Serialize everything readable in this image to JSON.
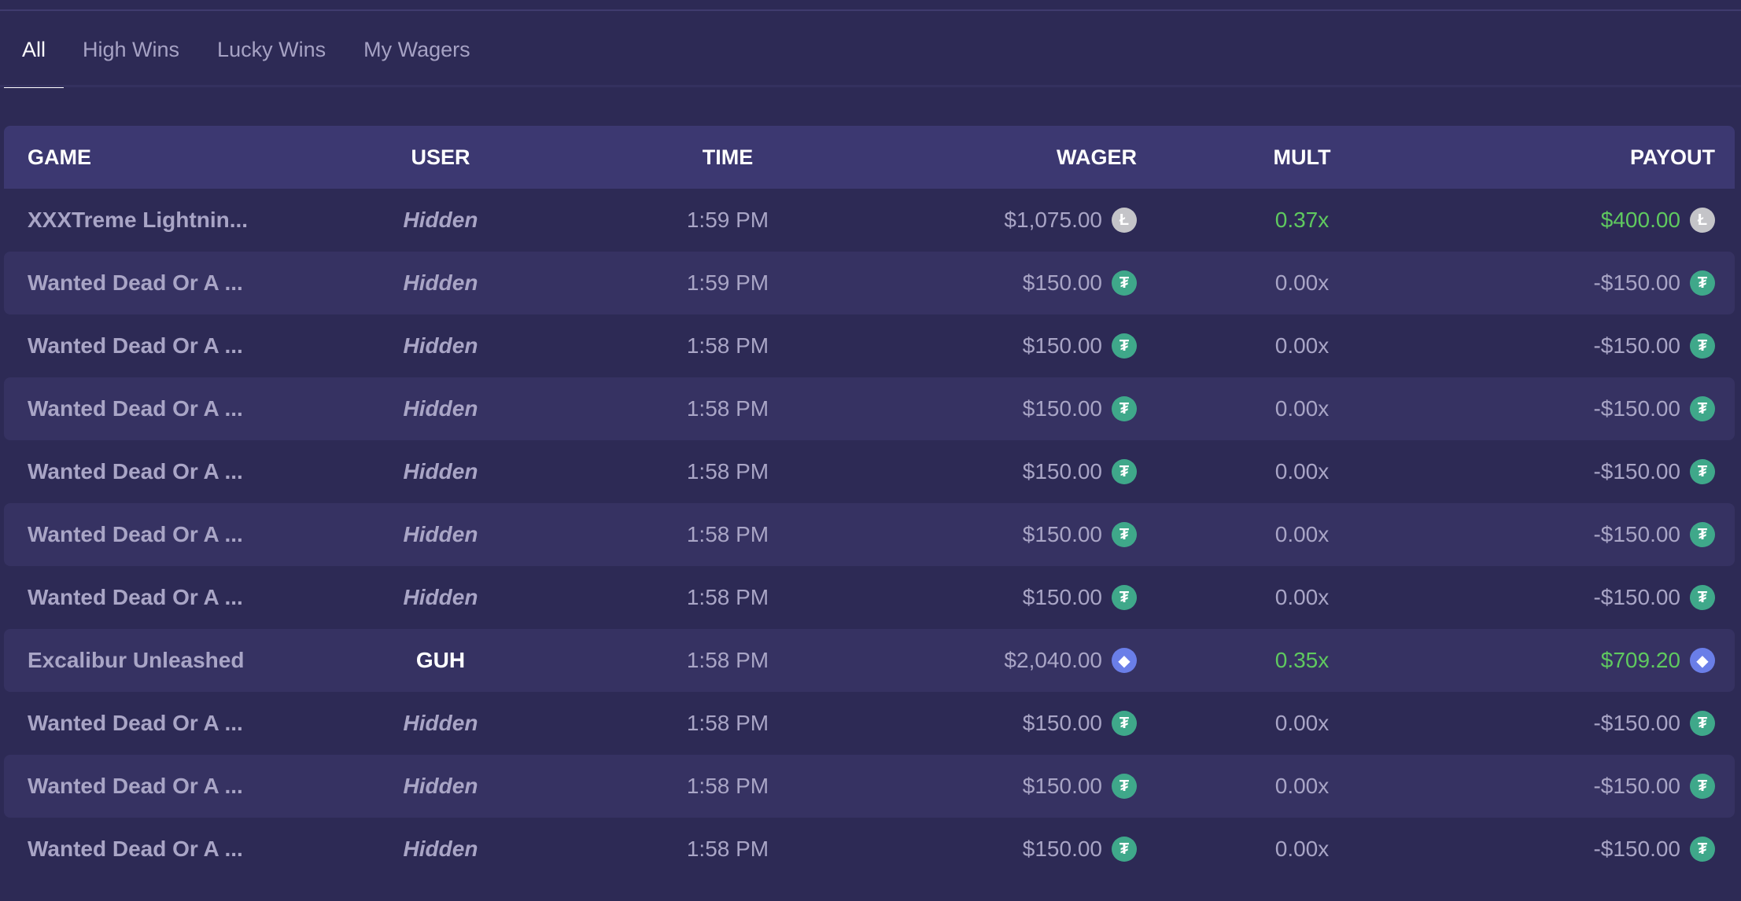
{
  "tabs": [
    {
      "label": "All",
      "active": true
    },
    {
      "label": "High Wins",
      "active": false
    },
    {
      "label": "Lucky Wins",
      "active": false
    },
    {
      "label": "My Wagers",
      "active": false
    }
  ],
  "columns": {
    "game": "GAME",
    "user": "USER",
    "time": "TIME",
    "wager": "WAGER",
    "mult": "MULT",
    "payout": "PAYOUT"
  },
  "rows": [
    {
      "game": "XXXTreme Lightnin...",
      "user": "Hidden",
      "hidden": true,
      "time": "1:59 PM",
      "wager": "$1,075.00",
      "currency": "ltc",
      "mult": "0.37x",
      "payout": "$400.00",
      "win": true
    },
    {
      "game": "Wanted Dead Or A ...",
      "user": "Hidden",
      "hidden": true,
      "time": "1:59 PM",
      "wager": "$150.00",
      "currency": "usdt",
      "mult": "0.00x",
      "payout": "-$150.00",
      "win": false
    },
    {
      "game": "Wanted Dead Or A ...",
      "user": "Hidden",
      "hidden": true,
      "time": "1:58 PM",
      "wager": "$150.00",
      "currency": "usdt",
      "mult": "0.00x",
      "payout": "-$150.00",
      "win": false
    },
    {
      "game": "Wanted Dead Or A ...",
      "user": "Hidden",
      "hidden": true,
      "time": "1:58 PM",
      "wager": "$150.00",
      "currency": "usdt",
      "mult": "0.00x",
      "payout": "-$150.00",
      "win": false
    },
    {
      "game": "Wanted Dead Or A ...",
      "user": "Hidden",
      "hidden": true,
      "time": "1:58 PM",
      "wager": "$150.00",
      "currency": "usdt",
      "mult": "0.00x",
      "payout": "-$150.00",
      "win": false
    },
    {
      "game": "Wanted Dead Or A ...",
      "user": "Hidden",
      "hidden": true,
      "time": "1:58 PM",
      "wager": "$150.00",
      "currency": "usdt",
      "mult": "0.00x",
      "payout": "-$150.00",
      "win": false
    },
    {
      "game": "Wanted Dead Or A ...",
      "user": "Hidden",
      "hidden": true,
      "time": "1:58 PM",
      "wager": "$150.00",
      "currency": "usdt",
      "mult": "0.00x",
      "payout": "-$150.00",
      "win": false
    },
    {
      "game": "Excalibur Unleashed",
      "user": "GUH",
      "hidden": false,
      "time": "1:58 PM",
      "wager": "$2,040.00",
      "currency": "eth",
      "mult": "0.35x",
      "payout": "$709.20",
      "win": true
    },
    {
      "game": "Wanted Dead Or A ...",
      "user": "Hidden",
      "hidden": true,
      "time": "1:58 PM",
      "wager": "$150.00",
      "currency": "usdt",
      "mult": "0.00x",
      "payout": "-$150.00",
      "win": false
    },
    {
      "game": "Wanted Dead Or A ...",
      "user": "Hidden",
      "hidden": true,
      "time": "1:58 PM",
      "wager": "$150.00",
      "currency": "usdt",
      "mult": "0.00x",
      "payout": "-$150.00",
      "win": false
    },
    {
      "game": "Wanted Dead Or A ...",
      "user": "Hidden",
      "hidden": true,
      "time": "1:58 PM",
      "wager": "$150.00",
      "currency": "usdt",
      "mult": "0.00x",
      "payout": "-$150.00",
      "win": false
    }
  ],
  "currency_icons": {
    "usdt": {
      "icon": "tether-icon",
      "glyph": "₮",
      "color": "#3fa88a"
    },
    "ltc": {
      "icon": "litecoin-icon",
      "glyph": "Ł",
      "color": "#c4c4c8"
    },
    "eth": {
      "icon": "ethereum-icon",
      "glyph": "◆",
      "color": "#6a7ee8"
    }
  },
  "colors": {
    "background": "#2d2a55",
    "header": "#3c3871",
    "alt_row": "#363262",
    "win": "#5fc95f",
    "muted_text": "#a9a5c6"
  }
}
